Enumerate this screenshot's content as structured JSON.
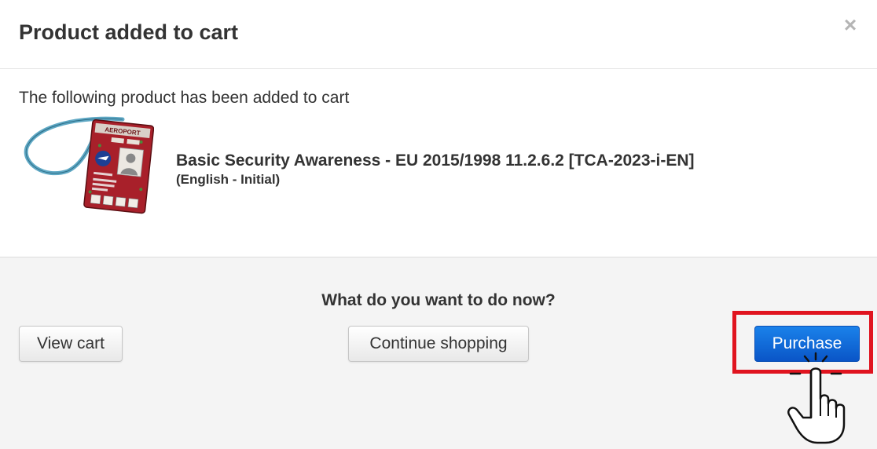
{
  "modal": {
    "title": "Product added to cart",
    "close_label": "×"
  },
  "body": {
    "intro": "The following product has been added to cart",
    "product": {
      "name": "Basic Security Awareness - EU 2015/1998 11.2.6.2 [TCA-2023-i-EN]",
      "variant": "(English - Initial)",
      "image_label": "AEROPORT"
    }
  },
  "footer": {
    "question": "What do you want to do now?",
    "view_cart_label": "View cart",
    "continue_label": "Continue shopping",
    "purchase_label": "Purchase"
  },
  "colors": {
    "primary": "#0a63d8",
    "highlight": "#e0141f",
    "footer_bg": "#f4f4f4"
  }
}
